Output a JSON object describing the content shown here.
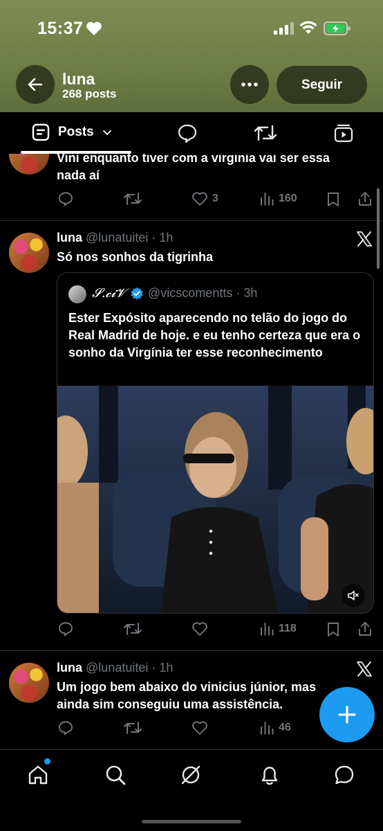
{
  "status_bar": {
    "time": "15:37"
  },
  "header": {
    "name": "luna",
    "posts_count": "268 posts",
    "follow_label": "Seguir"
  },
  "tabs": {
    "posts_label": "Posts"
  },
  "tweets": [
    {
      "text": "Vini enquanto tiver com a virginia vai ser essa",
      "text_line2": "nada aí",
      "likes": "3",
      "views": "160"
    },
    {
      "name": "luna",
      "handle_time": "@lunatuitei · 1h",
      "text": "Só nos sonhos da tigrinha",
      "quote": {
        "name": "𝓢.𝓬𝓲𝓥",
        "handle_time": "@vicscomentts · 3h",
        "text": "Ester Expósito aparecendo no telão do jogo do Real Madrid de hoje. e eu tenho certeza que era o sonho da Virgínia ter esse reconhecimento"
      },
      "views": "118"
    },
    {
      "name": "luna",
      "handle_time": "@lunatuitei · 1h",
      "text": "Um jogo bem abaixo do vinicius júnior, mas",
      "text_line2": "ainda sim conseguiu uma assistência.",
      "views": "46"
    }
  ],
  "colors": {
    "accent": "#1d9bf0",
    "verified": "#1d9bf0",
    "muted": "#71767b",
    "header_bg": "#6f7d46"
  }
}
